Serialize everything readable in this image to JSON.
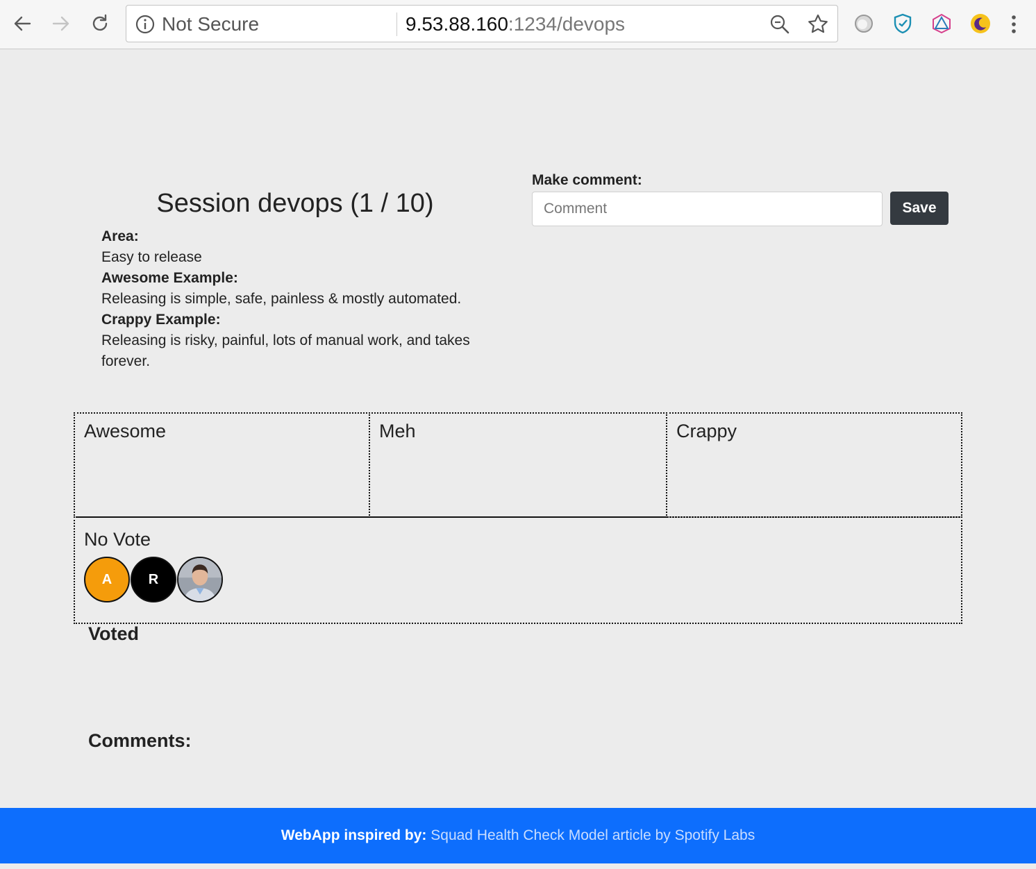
{
  "browser": {
    "security_label": "Not Secure",
    "url_host": "9.53.88.160",
    "url_path": ":1234/devops"
  },
  "session": {
    "title": "Session devops (1 / 10)",
    "area_label": "Area:",
    "area_value": "Easy to release",
    "awesome_label": "Awesome Example:",
    "awesome_value": "Releasing is simple, safe, painless & mostly automated.",
    "crappy_label": "Crappy Example:",
    "crappy_value": "Releasing is risky, painful, lots of manual work, and takes forever."
  },
  "comment_form": {
    "label": "Make comment:",
    "placeholder": "Comment",
    "save_label": "Save"
  },
  "vote_columns": {
    "awesome": "Awesome",
    "meh": "Meh",
    "crappy": "Crappy",
    "no_vote": "No Vote"
  },
  "no_vote_users": [
    {
      "initial": "A",
      "color": "#f59c0b"
    },
    {
      "initial": "R",
      "color": "#000000"
    },
    {
      "initial": "",
      "color": "#8a8f99",
      "is_photo": true
    }
  ],
  "sections": {
    "voted": "Voted",
    "comments": "Comments:"
  },
  "footer": {
    "prefix": "WebApp inspired by:",
    "link_text": "Squad Health Check Model article by Spotify Labs"
  },
  "colors": {
    "footer_bg": "#0d6efd",
    "save_bg": "#343a40"
  }
}
